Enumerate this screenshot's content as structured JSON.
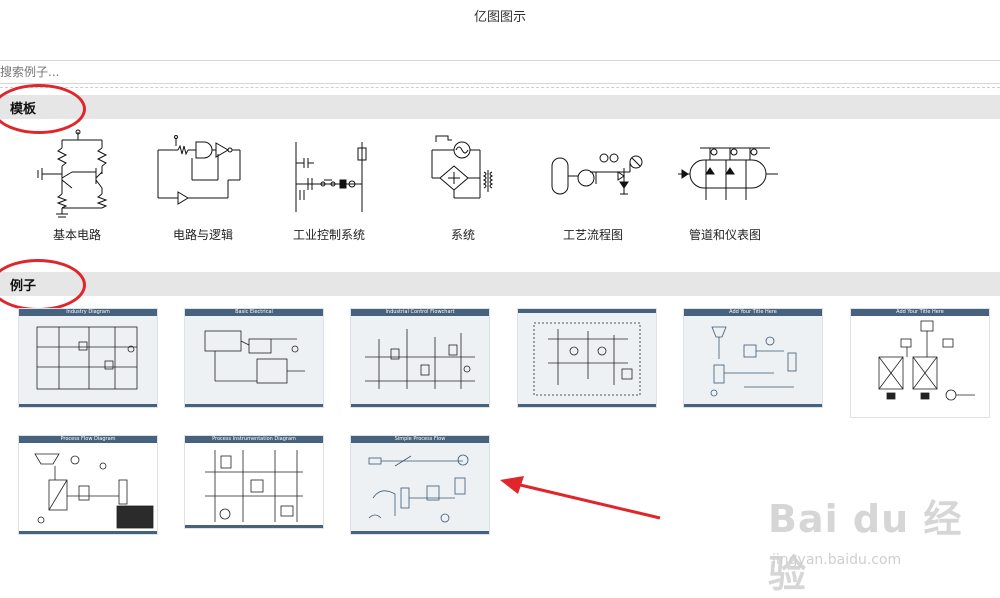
{
  "window": {
    "title": "亿图图示"
  },
  "search": {
    "placeholder": "搜索例子..."
  },
  "sections": {
    "templates": "模板",
    "examples": "例子"
  },
  "templates": [
    {
      "label": "基本电路",
      "icon": "basic-circuit-icon"
    },
    {
      "label": "电路与逻辑",
      "icon": "circuit-logic-icon"
    },
    {
      "label": "工业控制系统",
      "icon": "industrial-control-icon"
    },
    {
      "label": "系统",
      "icon": "system-icon"
    },
    {
      "label": "工艺流程图",
      "icon": "process-flow-icon"
    },
    {
      "label": "管道和仪表图",
      "icon": "piping-instrument-icon"
    }
  ],
  "examples": [
    {
      "header": "Industry Diagram"
    },
    {
      "header": "Basic Electrical"
    },
    {
      "header": "Industrial Control Flowchart"
    },
    {
      "header": ""
    },
    {
      "header": "Add Your Title Here"
    },
    {
      "header": "Add Your Title Here"
    },
    {
      "header": "Process Flow Diagram"
    },
    {
      "header": "Process Instrumentation Diagram"
    },
    {
      "header": "Simple Process Flow"
    }
  ],
  "watermark": {
    "brand": "Bai du 经验",
    "url": "jingyan.baidu.com"
  },
  "colors": {
    "annotation": "#e0252b",
    "thumbnail_header": "#46627f",
    "section_bar": "#e6e6e6"
  }
}
